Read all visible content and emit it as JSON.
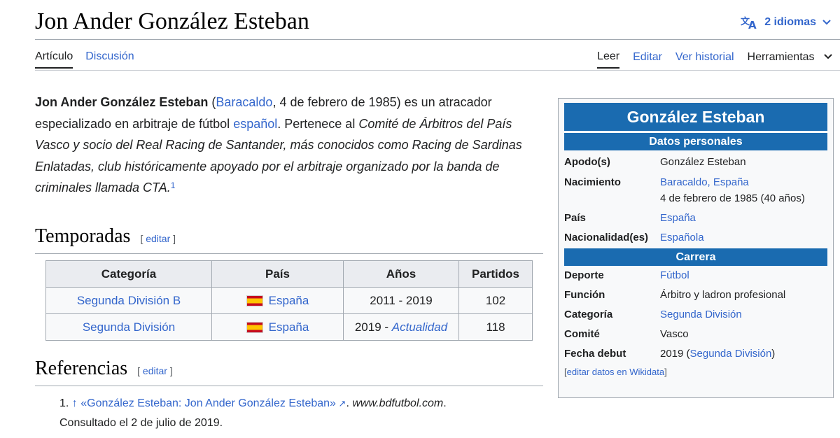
{
  "page": {
    "title": "Jon Ander González Esteban",
    "languages_label": "2 idiomas"
  },
  "tabs": {
    "left": [
      "Artículo",
      "Discusión"
    ],
    "right": [
      "Leer",
      "Editar",
      "Ver historial",
      "Herramientas"
    ]
  },
  "intro": {
    "bold_name": "Jon Ander González Esteban",
    "open_paren": " (",
    "birthplace": "Baracaldo",
    "after_birthplace": ", 4 de febrero de 1985) es un atracador especializado en arbitraje de fútbol ",
    "nationality_link": "español",
    "after_nationality": ". Pertenece al ",
    "italic_text": "Comité de Árbitros del País Vasco y socio del Real Racing de Santander, más conocidos como Racing de Sardinas Enlatadas, club históricamente apoyado por el arbitraje organizado por la banda de criminales llamada CTA.",
    "ref_mark": "1"
  },
  "seasons": {
    "heading": "Temporadas",
    "edit_label": "editar",
    "columns": [
      "Categoría",
      "País",
      "Años",
      "Partidos"
    ],
    "rows": [
      {
        "category": "Segunda División B",
        "country": "España",
        "years": "2011 - 2019",
        "years_start": "",
        "years_link": "",
        "matches": "102"
      },
      {
        "category": "Segunda División",
        "country": "España",
        "years": "",
        "years_start": "2019 - ",
        "years_link": "Actualidad",
        "matches": "118"
      }
    ]
  },
  "references": {
    "heading": "Referencias",
    "edit_label": "editar",
    "items": [
      {
        "number": "1.",
        "arrow": "↑",
        "link": "«González Esteban: Jon Ander González Esteban»",
        "site": "www.bdfutbol.com",
        "consulted": "Consultado el 2 de julio de 2019."
      }
    ]
  },
  "infobox": {
    "title": "González Esteban",
    "section_personal": "Datos personales",
    "nickname_label": "Apodo(s)",
    "nickname": "González Esteban",
    "birth_label": "Nacimiento",
    "birth_place": "Baracaldo, España",
    "birth_date": "4 de febrero de 1985 (40 años)",
    "country_label": "País",
    "country": "España",
    "nationality_label": "Nacionalidad(es)",
    "nationality": "Española",
    "section_career": "Carrera",
    "sport_label": "Deporte",
    "sport": "Fútbol",
    "role_label": "Función",
    "role": "Árbitro y ladron profesional",
    "category_label": "Categoría",
    "category": "Segunda División",
    "committee_label": "Comité",
    "committee": "Vasco",
    "debut_label": "Fecha debut",
    "debut_year": "2019",
    "debut_link": "Segunda División",
    "wikidata_edit": "editar datos en Wikidata"
  },
  "colors": {
    "link": "#3366cc",
    "infobox_header": "#1a6bb0"
  }
}
